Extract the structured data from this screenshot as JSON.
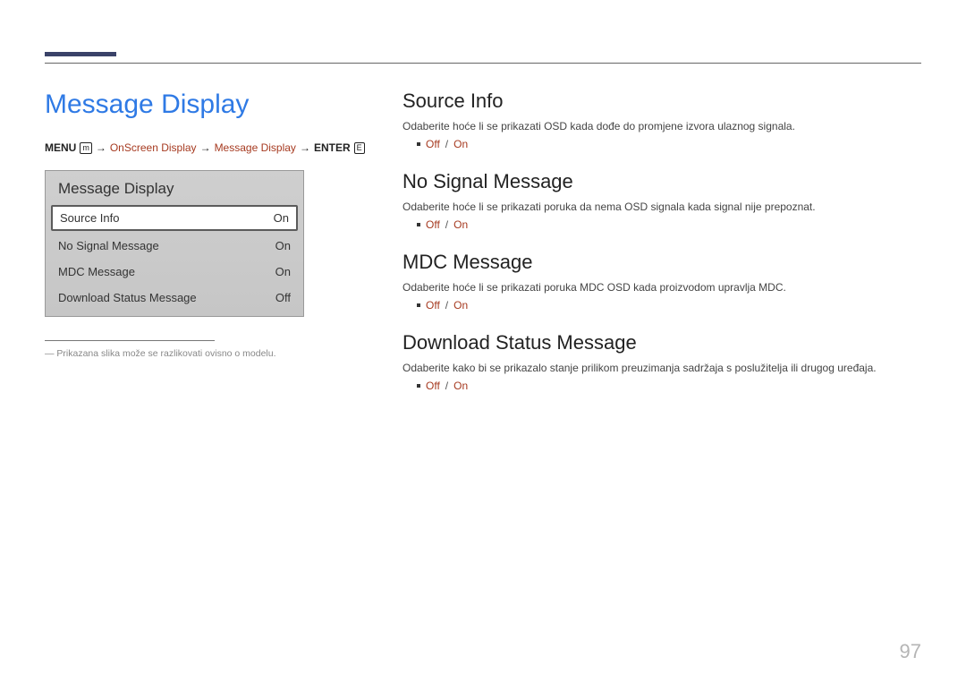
{
  "page_number": "97",
  "left": {
    "title": "Message Display",
    "breadcrumb": {
      "menu": "MENU",
      "menu_icon": "m",
      "crumb1": "OnScreen Display",
      "crumb2": "Message Display",
      "enter": "ENTER",
      "enter_icon": "E"
    },
    "osd": {
      "title": "Message Display",
      "rows": [
        {
          "label": "Source Info",
          "value": "On",
          "selected": true
        },
        {
          "label": "No Signal Message",
          "value": "On",
          "selected": false
        },
        {
          "label": "MDC Message",
          "value": "On",
          "selected": false
        },
        {
          "label": "Download Status Message",
          "value": "Off",
          "selected": false
        }
      ]
    },
    "note": "― Prikazana slika može se razlikovati ovisno o modelu."
  },
  "right": {
    "sections": [
      {
        "heading": "Source Info",
        "desc": "Odaberite hoće li se prikazati OSD kada dođe do promjene izvora ulaznog signala.",
        "off": "Off",
        "sep": "/",
        "on": "On"
      },
      {
        "heading": "No Signal Message",
        "desc": "Odaberite hoće li se prikazati poruka da nema OSD signala kada signal nije prepoznat.",
        "off": "Off",
        "sep": "/",
        "on": "On"
      },
      {
        "heading": "MDC Message",
        "desc": "Odaberite hoće li se prikazati poruka MDC OSD kada proizvodom upravlja MDC.",
        "off": "Off",
        "sep": "/",
        "on": "On"
      },
      {
        "heading": "Download Status Message",
        "desc": "Odaberite kako bi se prikazalo stanje prilikom preuzimanja sadržaja s poslužitelja ili drugog uređaja.",
        "off": "Off",
        "sep": "/",
        "on": "On"
      }
    ]
  }
}
